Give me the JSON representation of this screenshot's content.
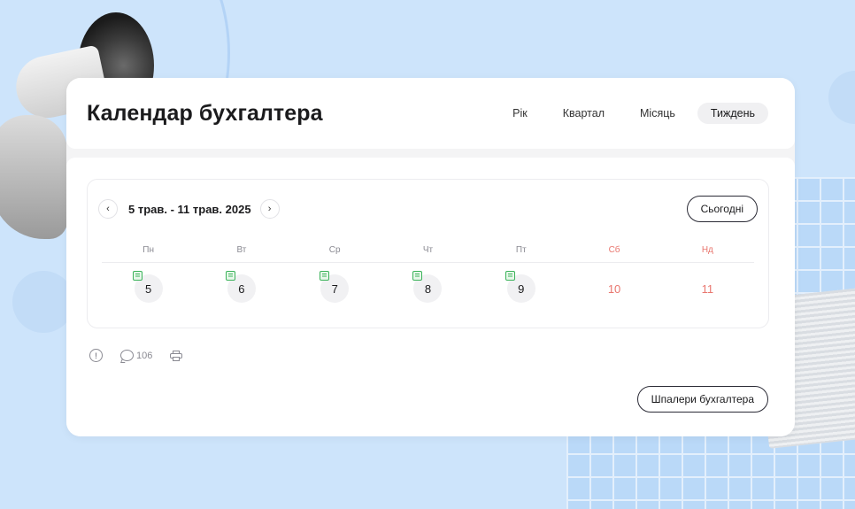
{
  "header": {
    "title": "Календар бухгалтера",
    "tabs": [
      {
        "label": "Рік",
        "active": false
      },
      {
        "label": "Квартал",
        "active": false
      },
      {
        "label": "Місяць",
        "active": false
      },
      {
        "label": "Тиждень",
        "active": true
      }
    ]
  },
  "calendar": {
    "date_range": "5 трав. - 11 трав. 2025",
    "prev_icon": "chevron-left-icon",
    "next_icon": "chevron-right-icon",
    "today_label": "Сьогодні",
    "weekdays": [
      {
        "label": "Пн",
        "weekend": false
      },
      {
        "label": "Вт",
        "weekend": false
      },
      {
        "label": "Ср",
        "weekend": false
      },
      {
        "label": "Чт",
        "weekend": false
      },
      {
        "label": "Пт",
        "weekend": false
      },
      {
        "label": "Сб",
        "weekend": true
      },
      {
        "label": "Нд",
        "weekend": true
      }
    ],
    "days": [
      {
        "num": "5",
        "has_note": true,
        "weekend": false
      },
      {
        "num": "6",
        "has_note": true,
        "weekend": false
      },
      {
        "num": "7",
        "has_note": true,
        "weekend": false
      },
      {
        "num": "8",
        "has_note": true,
        "weekend": false
      },
      {
        "num": "9",
        "has_note": true,
        "weekend": false
      },
      {
        "num": "10",
        "has_note": false,
        "weekend": true
      },
      {
        "num": "11",
        "has_note": false,
        "weekend": true
      }
    ],
    "weekend_color": "#e9776f",
    "note_color": "#3bb35a"
  },
  "actions": {
    "info_icon": "info-icon",
    "comments_count": "106",
    "print_icon": "printer-icon"
  },
  "wallpaper_button": "Шпалери бухгалтера"
}
